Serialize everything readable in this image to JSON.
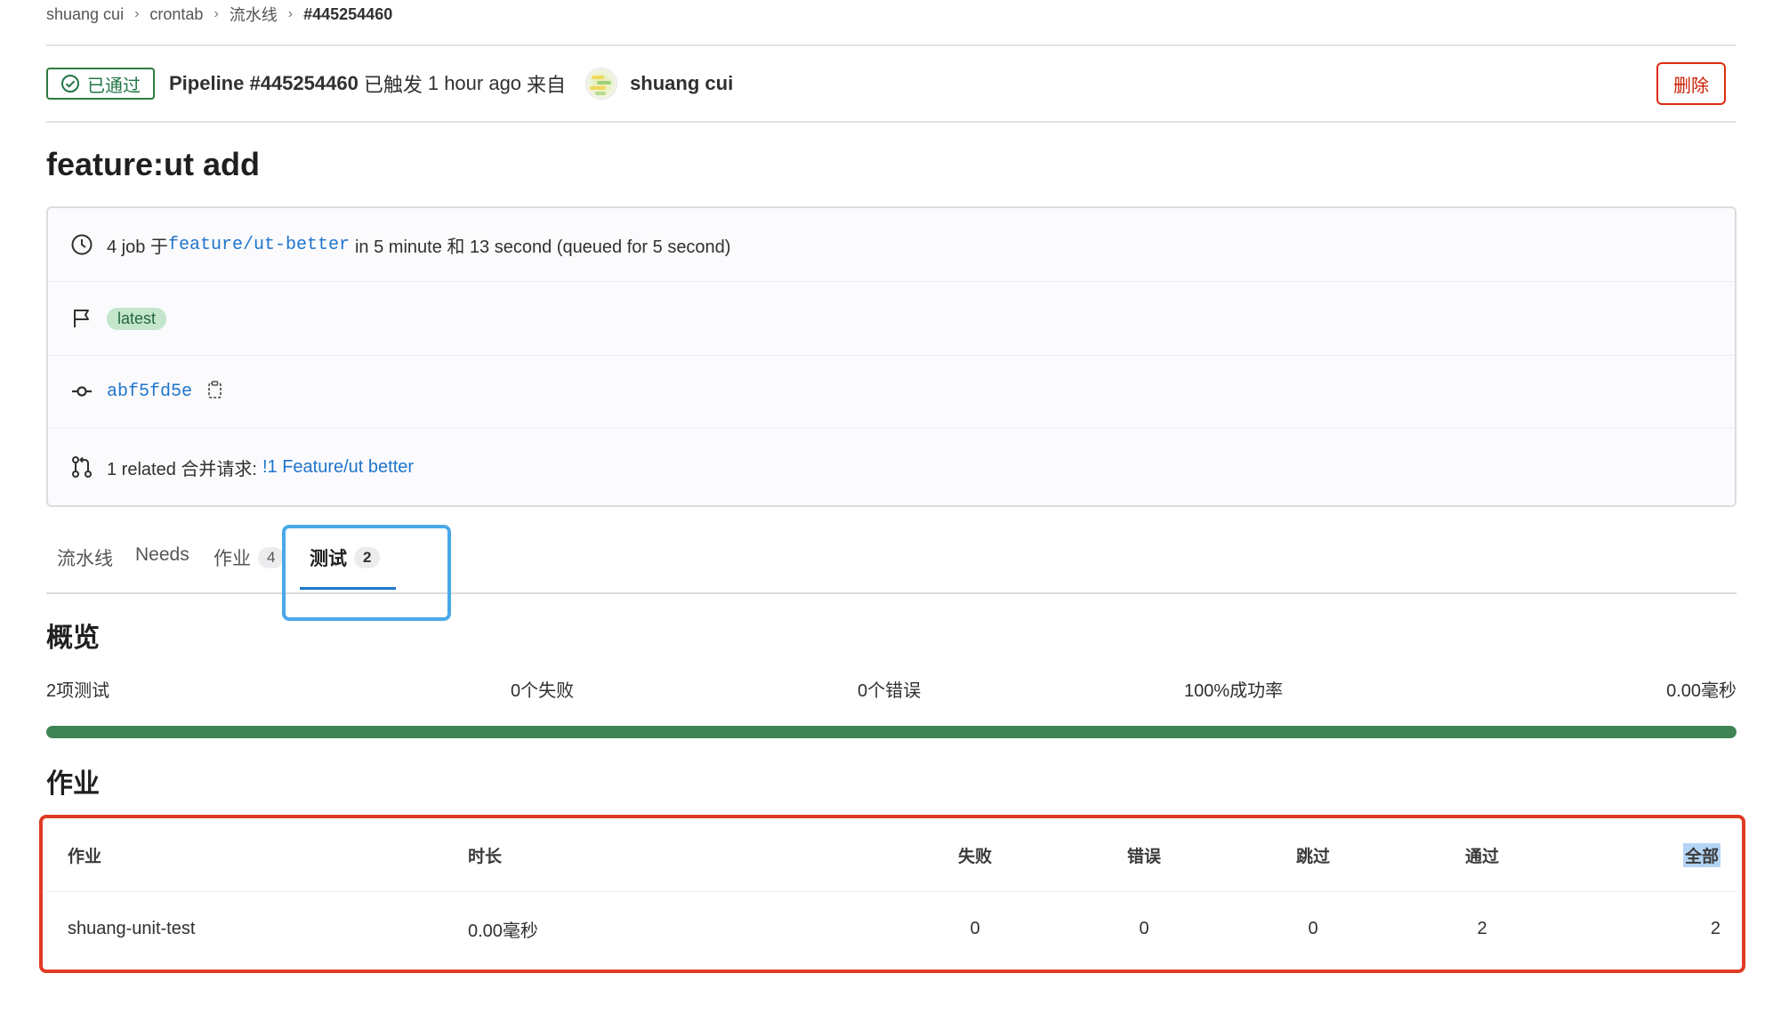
{
  "breadcrumb": [
    "shuang cui",
    "crontab",
    "流水线",
    "#445254460"
  ],
  "header": {
    "status_label": "已通过",
    "pipeline_label": "Pipeline #445254460",
    "triggered_text": "已触发",
    "time_ago": "1 hour ago",
    "from_text": "来自",
    "author": "shuang cui",
    "delete_label": "删除"
  },
  "title": "feature:ut add",
  "info": {
    "jobs_prefix": "4 job 于",
    "branch": "feature/ut-better",
    "duration_text": "in 5 minute 和 13 second (queued for 5 second)",
    "tag": "latest",
    "commit_sha": "abf5fd5e",
    "mr_prefix": "1 related 合并请求:",
    "mr_link": "!1 Feature/ut better"
  },
  "tabs": [
    {
      "label": "流水线",
      "count": null
    },
    {
      "label": "Needs",
      "count": null
    },
    {
      "label": "作业",
      "count": "4"
    },
    {
      "label": "测试",
      "count": "2"
    }
  ],
  "overview": {
    "title": "概览",
    "tests": "2项测试",
    "failed": "0个失败",
    "errors": "0个错误",
    "success_rate": "100%成功率",
    "duration": "0.00毫秒",
    "success_fraction": 1.0
  },
  "jobs": {
    "title": "作业",
    "columns": [
      "作业",
      "时长",
      "失败",
      "错误",
      "跳过",
      "通过",
      "全部"
    ],
    "rows": [
      [
        "shuang-unit-test",
        "0.00毫秒",
        "0",
        "0",
        "0",
        "2",
        "2"
      ]
    ]
  },
  "colors": {
    "success": "#3e8454",
    "link": "#1f75cb",
    "danger": "#dd2b0e",
    "tab_highlight": "#4aa8e8",
    "table_highlight": "#e03b24"
  }
}
